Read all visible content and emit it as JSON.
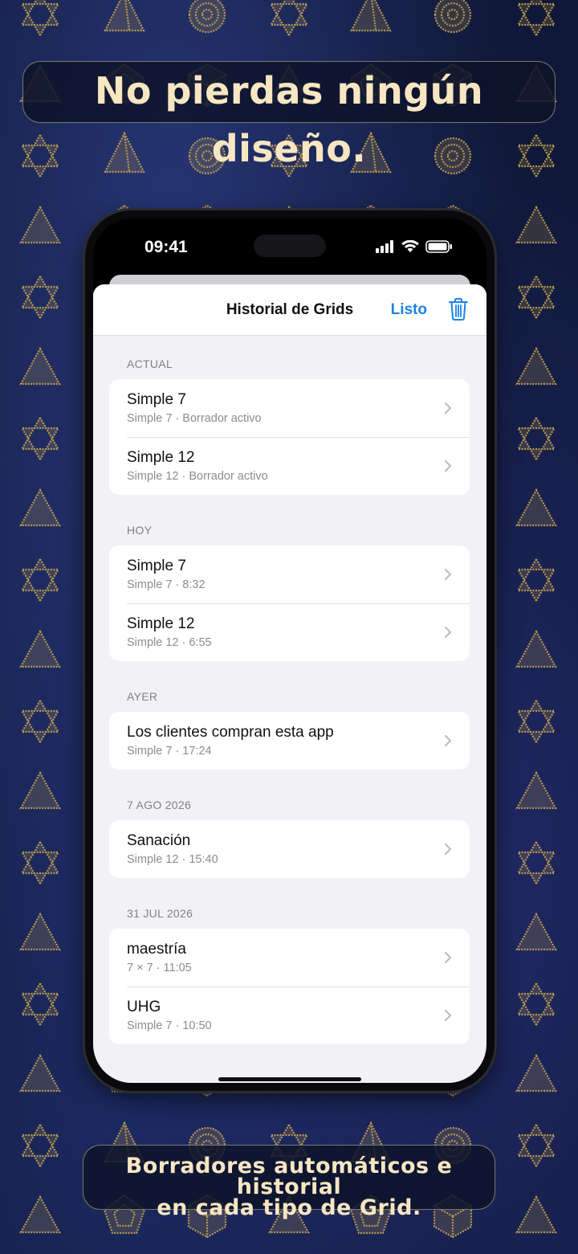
{
  "promo": {
    "headline": "No pierdas ningún diseño.",
    "caption_line1": "Borradores automáticos e historial",
    "caption_line2": "en cada tipo de Grid."
  },
  "status_bar": {
    "time": "09:41",
    "icons": [
      "cellular-signal-icon",
      "wifi-icon",
      "battery-icon"
    ]
  },
  "nav": {
    "title": "Historial de Grids",
    "done_label": "Listo",
    "trash_icon": "trash-icon"
  },
  "colors": {
    "accent": "#1a84e8",
    "background_gold": "#c9a44f",
    "background_navy": "#0f1838",
    "banner_text": "#f7e6c2"
  },
  "sections": [
    {
      "header": "ACTUAL",
      "items": [
        {
          "title": "Simple 7",
          "subtitle": "Simple 7 · Borrador activo"
        },
        {
          "title": "Simple 12",
          "subtitle": "Simple 12 · Borrador activo"
        }
      ]
    },
    {
      "header": "HOY",
      "items": [
        {
          "title": "Simple 7",
          "subtitle": "Simple 7 · 8:32"
        },
        {
          "title": "Simple 12",
          "subtitle": "Simple 12 · 6:55"
        }
      ]
    },
    {
      "header": "AYER",
      "items": [
        {
          "title": "Los clientes compran esta app",
          "subtitle": "Simple 7 · 17:24"
        }
      ]
    },
    {
      "header": "7 AGO 2026",
      "items": [
        {
          "title": "Sanación",
          "subtitle": "Simple 12 · 15:40"
        }
      ]
    },
    {
      "header": "31 JUL 2026",
      "items": [
        {
          "title": "maestría",
          "subtitle": "7 × 7 · 11:05"
        },
        {
          "title": "UHG",
          "subtitle": "Simple 7 · 10:50"
        }
      ]
    }
  ]
}
